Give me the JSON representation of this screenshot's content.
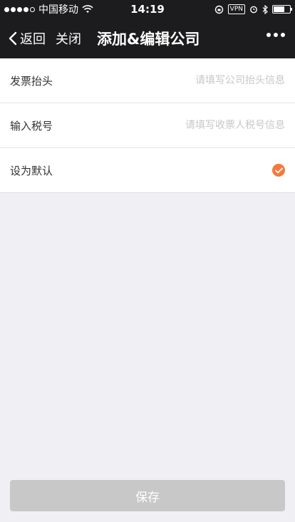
{
  "status_bar": {
    "carrier": "中国移动",
    "time": "14:19",
    "vpn": "VPN"
  },
  "nav": {
    "back_label": "返回",
    "close_label": "关闭",
    "title": "添加&编辑公司"
  },
  "form": {
    "invoice_header": {
      "label": "发票抬头",
      "placeholder": "请填写公司抬头信息",
      "value": ""
    },
    "tax_number": {
      "label": "输入税号",
      "placeholder": "请填写收票人税号信息",
      "value": ""
    },
    "default": {
      "label": "设为默认",
      "checked": true
    }
  },
  "save_button": {
    "label": "保存",
    "enabled": false
  },
  "colors": {
    "accent": "#f47a3c",
    "navbar_bg": "#1c1c1e",
    "page_bg": "#efeff4",
    "disabled_button": "#c8c8c8"
  }
}
